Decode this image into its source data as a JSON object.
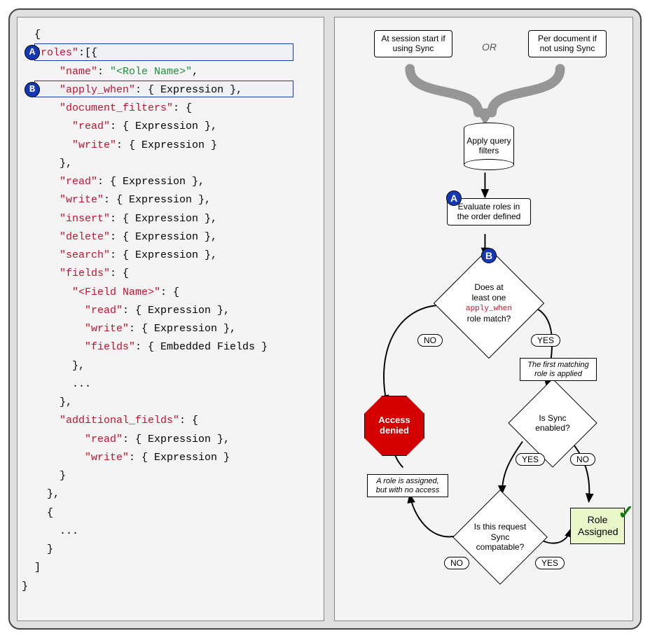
{
  "code": {
    "lines": [
      {
        "indent": 1,
        "parts": [
          {
            "text": "{",
            "cls": "k-black"
          }
        ]
      },
      {
        "indent": 1,
        "parts": [
          {
            "text": "\"roles\"",
            "cls": "k-red"
          },
          {
            "text": ":[{",
            "cls": "k-black"
          }
        ],
        "badge": "A",
        "hl": true
      },
      {
        "indent": 3,
        "parts": [
          {
            "text": "\"name\"",
            "cls": "k-red"
          },
          {
            "text": ": ",
            "cls": "k-black"
          },
          {
            "text": "\"<Role Name>\"",
            "cls": "k-green"
          },
          {
            "text": ",",
            "cls": "k-black"
          }
        ]
      },
      {
        "indent": 3,
        "parts": [
          {
            "text": "\"apply_when\"",
            "cls": "k-red"
          },
          {
            "text": ": { Expression },",
            "cls": "k-black"
          }
        ],
        "badge": "B",
        "hl": true
      },
      {
        "indent": 3,
        "parts": [
          {
            "text": "\"document_filters\"",
            "cls": "k-red"
          },
          {
            "text": ": {",
            "cls": "k-black"
          }
        ]
      },
      {
        "indent": 4,
        "parts": [
          {
            "text": "\"read\"",
            "cls": "k-red"
          },
          {
            "text": ": { Expression },",
            "cls": "k-black"
          }
        ]
      },
      {
        "indent": 4,
        "parts": [
          {
            "text": "\"write\"",
            "cls": "k-red"
          },
          {
            "text": ": { Expression }",
            "cls": "k-black"
          }
        ]
      },
      {
        "indent": 3,
        "parts": [
          {
            "text": "},",
            "cls": "k-black"
          }
        ]
      },
      {
        "indent": 3,
        "parts": [
          {
            "text": "\"read\"",
            "cls": "k-red"
          },
          {
            "text": ": { Expression },",
            "cls": "k-black"
          }
        ]
      },
      {
        "indent": 3,
        "parts": [
          {
            "text": "\"write\"",
            "cls": "k-red"
          },
          {
            "text": ": { Expression },",
            "cls": "k-black"
          }
        ]
      },
      {
        "indent": 3,
        "parts": [
          {
            "text": "\"insert\"",
            "cls": "k-red"
          },
          {
            "text": ": { Expression },",
            "cls": "k-black"
          }
        ]
      },
      {
        "indent": 3,
        "parts": [
          {
            "text": "\"delete\"",
            "cls": "k-red"
          },
          {
            "text": ": { Expression },",
            "cls": "k-black"
          }
        ]
      },
      {
        "indent": 3,
        "parts": [
          {
            "text": "\"search\"",
            "cls": "k-red"
          },
          {
            "text": ": { Expression },",
            "cls": "k-black"
          }
        ]
      },
      {
        "indent": 3,
        "parts": [
          {
            "text": "\"fields\"",
            "cls": "k-red"
          },
          {
            "text": ": {",
            "cls": "k-black"
          }
        ]
      },
      {
        "indent": 4,
        "parts": [
          {
            "text": "\"<Field Name>\"",
            "cls": "k-red"
          },
          {
            "text": ": {",
            "cls": "k-black"
          }
        ]
      },
      {
        "indent": 5,
        "parts": [
          {
            "text": "\"read\"",
            "cls": "k-red"
          },
          {
            "text": ": { Expression },",
            "cls": "k-black"
          }
        ]
      },
      {
        "indent": 5,
        "parts": [
          {
            "text": "\"write\"",
            "cls": "k-red"
          },
          {
            "text": ": { Expression },",
            "cls": "k-black"
          }
        ]
      },
      {
        "indent": 5,
        "parts": [
          {
            "text": "\"fields\"",
            "cls": "k-red"
          },
          {
            "text": ": { Embedded Fields }",
            "cls": "k-black"
          }
        ]
      },
      {
        "indent": 4,
        "parts": [
          {
            "text": "},",
            "cls": "k-black"
          }
        ]
      },
      {
        "indent": 4,
        "parts": [
          {
            "text": "...",
            "cls": "k-black"
          }
        ]
      },
      {
        "indent": 3,
        "parts": [
          {
            "text": "},",
            "cls": "k-black"
          }
        ]
      },
      {
        "indent": 3,
        "parts": [
          {
            "text": "\"additional_fields\"",
            "cls": "k-red"
          },
          {
            "text": ": {",
            "cls": "k-black"
          }
        ]
      },
      {
        "indent": 5,
        "parts": [
          {
            "text": "\"read\"",
            "cls": "k-red"
          },
          {
            "text": ": { Expression },",
            "cls": "k-black"
          }
        ]
      },
      {
        "indent": 5,
        "parts": [
          {
            "text": "\"write\"",
            "cls": "k-red"
          },
          {
            "text": ": { Expression }",
            "cls": "k-black"
          }
        ]
      },
      {
        "indent": 3,
        "parts": [
          {
            "text": "}",
            "cls": "k-black"
          }
        ]
      },
      {
        "indent": 2,
        "parts": [
          {
            "text": "},",
            "cls": "k-black"
          }
        ]
      },
      {
        "indent": 2,
        "parts": [
          {
            "text": "{",
            "cls": "k-black"
          }
        ]
      },
      {
        "indent": 3,
        "parts": [
          {
            "text": "...",
            "cls": "k-black"
          }
        ]
      },
      {
        "indent": 2,
        "parts": [
          {
            "text": "}",
            "cls": "k-black"
          }
        ]
      },
      {
        "indent": 1,
        "parts": [
          {
            "text": "]",
            "cls": "k-black"
          }
        ]
      },
      {
        "indent": 0,
        "parts": [
          {
            "text": "}",
            "cls": "k-black"
          }
        ]
      }
    ]
  },
  "flow": {
    "start_left": "At session start if using Sync",
    "start_right": "Per document if not using Sync",
    "or": "OR",
    "apply_filters": "Apply query filters",
    "eval_roles": "Evaluate roles in the order defined",
    "badge_a": "A",
    "badge_b": "B",
    "d1_l1": "Does at",
    "d1_l2": "least one",
    "d1_code": "apply_when",
    "d1_l3": "role match?",
    "yes": "YES",
    "no": "NO",
    "first_match": "The first matching role is applied",
    "d2": "Is Sync enabled?",
    "d3": "Is this request Sync compatable?",
    "access_denied": "Access denied",
    "note_no_access": "A role is assigned, but with no access",
    "role_assigned": "Role Assigned"
  }
}
